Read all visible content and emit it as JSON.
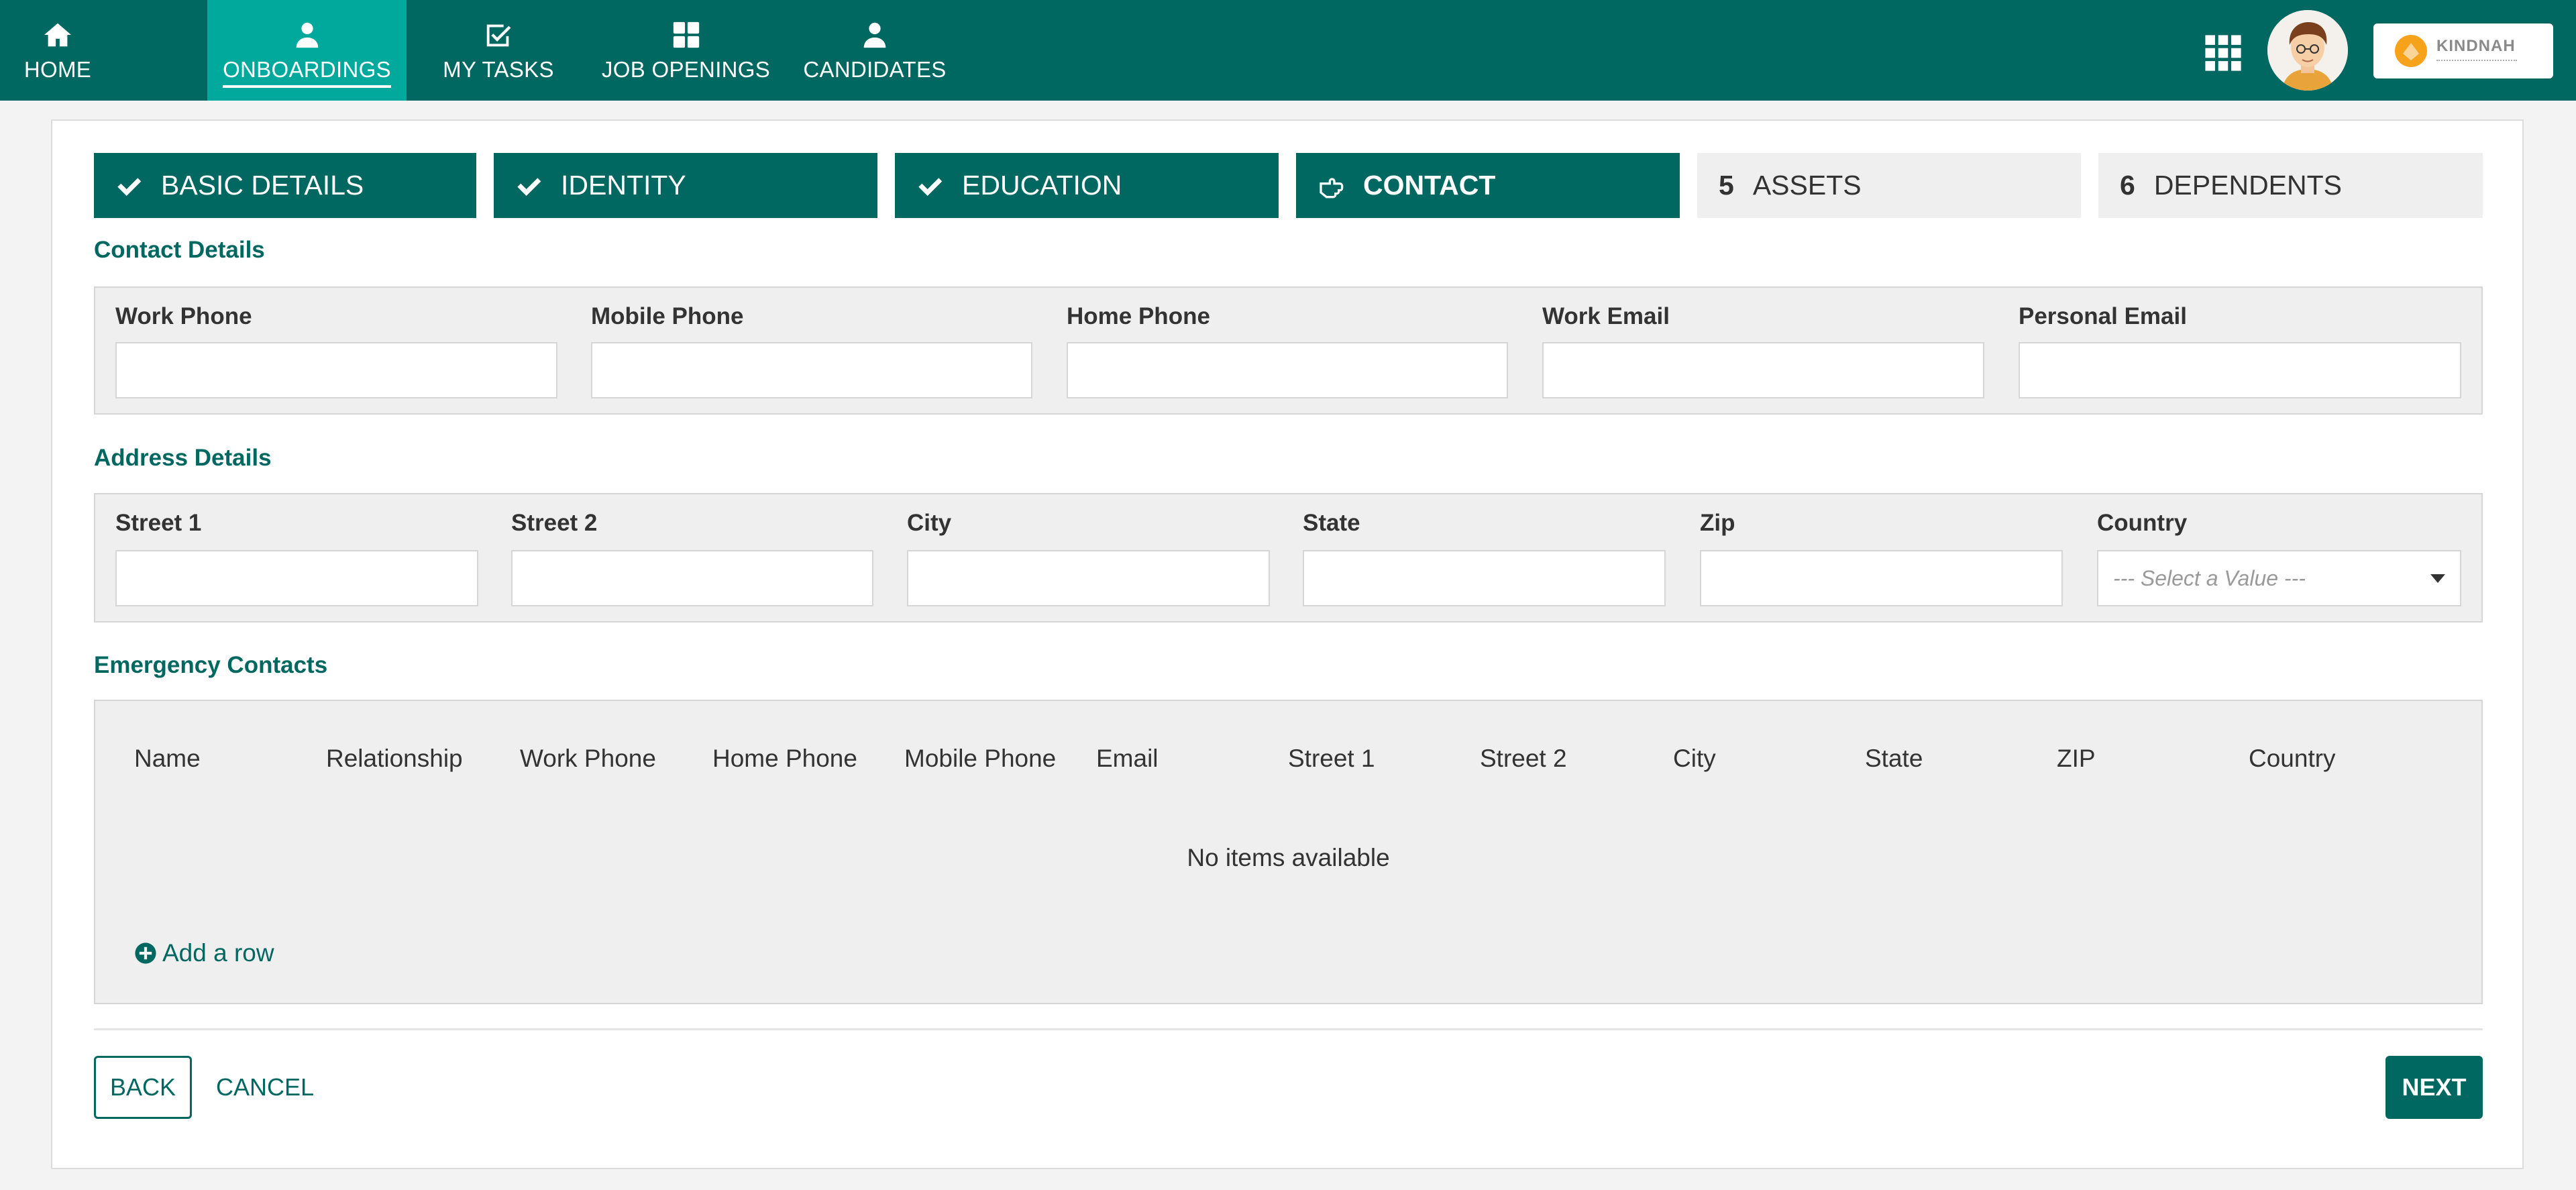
{
  "nav": {
    "items": [
      {
        "label": "HOME",
        "icon": "home-icon"
      },
      {
        "label": "ONBOARDINGS",
        "icon": "person-icon",
        "active": true
      },
      {
        "label": "MY TASKS",
        "icon": "tasks-check-icon"
      },
      {
        "label": "JOB OPENINGS",
        "icon": "grid-icon"
      },
      {
        "label": "CANDIDATES",
        "icon": "person-icon"
      }
    ],
    "apps_icon": "apps-grid-icon",
    "avatar_icon": "user-avatar",
    "logo_text": "KINDNAH"
  },
  "steps": [
    {
      "label": "BASIC DETAILS",
      "status": "done",
      "icon": "check-icon"
    },
    {
      "label": "IDENTITY",
      "status": "done",
      "icon": "check-icon"
    },
    {
      "label": "EDUCATION",
      "status": "done",
      "icon": "check-icon"
    },
    {
      "label": "CONTACT",
      "status": "current",
      "icon": "hand-pointer-icon"
    },
    {
      "number": "5",
      "label": "ASSETS",
      "status": "todo"
    },
    {
      "number": "6",
      "label": "DEPENDENTS",
      "status": "todo"
    }
  ],
  "contact": {
    "title": "Contact Details",
    "fields": [
      {
        "label": "Work Phone",
        "value": ""
      },
      {
        "label": "Mobile Phone",
        "value": ""
      },
      {
        "label": "Home Phone",
        "value": ""
      },
      {
        "label": "Work Email",
        "value": ""
      },
      {
        "label": "Personal Email",
        "value": ""
      }
    ]
  },
  "address": {
    "title": "Address Details",
    "fields": [
      {
        "label": "Street 1",
        "value": ""
      },
      {
        "label": "Street 2",
        "value": ""
      },
      {
        "label": "City",
        "value": ""
      },
      {
        "label": "State",
        "value": ""
      },
      {
        "label": "Zip",
        "value": ""
      }
    ],
    "country": {
      "label": "Country",
      "placeholder": "--- Select a Value ---"
    }
  },
  "emergency": {
    "title": "Emergency Contacts",
    "columns": [
      "Name",
      "Relationship",
      "Work Phone",
      "Home Phone",
      "Mobile Phone",
      "Email",
      "Street 1",
      "Street 2",
      "City",
      "State",
      "ZIP",
      "Country"
    ],
    "empty_message": "No items available",
    "add_row_label": "Add a row"
  },
  "actions": {
    "back": "BACK",
    "cancel": "CANCEL",
    "next": "NEXT"
  },
  "colors": {
    "primary": "#006860",
    "active_nav": "#00a99c",
    "panel_bg": "#efefef"
  }
}
